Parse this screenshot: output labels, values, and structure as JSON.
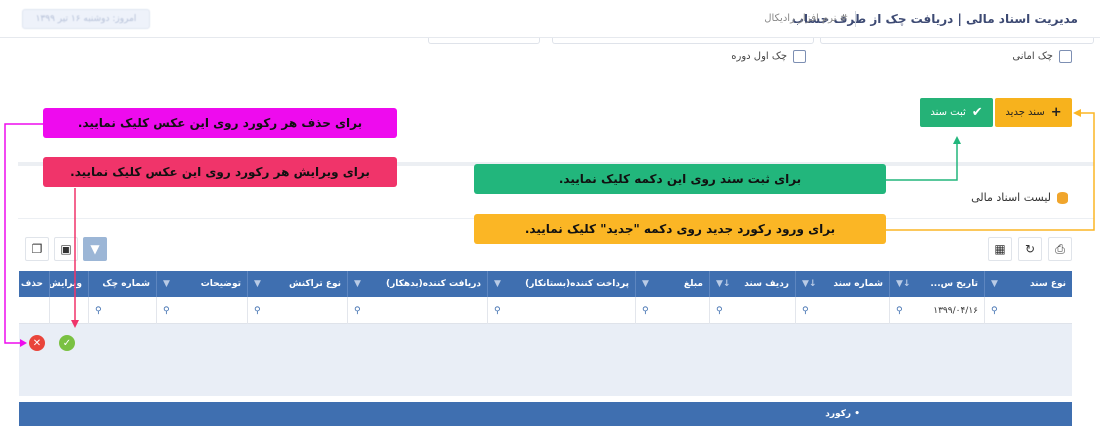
{
  "header": {
    "title": "مدیریت اسناد مالی | دریافت چک از طرف حساب",
    "app_name": "# نرم افزار رادیکال",
    "date_text": "امروز: دوشنبه ۱۶ تیر ۱۳۹۹"
  },
  "checkboxes": [
    {
      "label": "چک امانی",
      "checked": false
    },
    {
      "label": "چک اول دوره",
      "checked": false
    }
  ],
  "toolbar": {
    "new_label": "سند جدید",
    "save_label": "ثبت سند"
  },
  "panel": {
    "title": "لیست اسناد مالی"
  },
  "table": {
    "columns": [
      {
        "label": "نوع سند",
        "filter_value": ""
      },
      {
        "label": "تاریخ س...",
        "filter_value": "۱۳۹۹/۰۴/۱۶"
      },
      {
        "label": "شماره سند",
        "filter_value": ""
      },
      {
        "label": "ردیف سند",
        "filter_value": ""
      },
      {
        "label": "مبلغ",
        "filter_value": ""
      },
      {
        "label": "پرداخت کننده(بستانکار)",
        "filter_value": ""
      },
      {
        "label": "دریافت کننده(بدهکار)",
        "filter_value": ""
      },
      {
        "label": "نوع تراکنش",
        "filter_value": ""
      },
      {
        "label": "توضیحات",
        "filter_value": ""
      },
      {
        "label": "شماره چک",
        "filter_value": ""
      },
      {
        "label": "ویرایش",
        "filter_value": ""
      },
      {
        "label": "حذف",
        "filter_value": ""
      }
    ],
    "footer": "• رکورد"
  },
  "callouts": {
    "delete": "برای حذف هر رکورد روی این عکس کلیک نمایید.",
    "edit": "برای ویرایش هر رکورد روی این عکس کلیک نمایید.",
    "save": "برای ثبت سند روی این دکمه کلیک نمایید.",
    "new": "برای ورود رکورد جدید روی دکمه \"جدید\" کلیک نمایید."
  },
  "colors": {
    "header_blue": "#3f6fb0",
    "new_button": "#f7b21d",
    "save_button": "#25b277",
    "callout_delete": "#ee0bee",
    "callout_edit": "#f0346a",
    "callout_save": "#22b67c",
    "callout_new": "#fbb625"
  },
  "icons": {
    "new": "plus-icon",
    "save": "check-icon",
    "print": "print-icon",
    "refresh": "refresh-icon",
    "columns": "columns-icon",
    "filter": "filter-icon",
    "excel": "excel-icon",
    "copy": "copy-icon",
    "delete": "delete-icon",
    "edit": "edit-icon",
    "database": "database-icon",
    "search": "search-icon"
  }
}
